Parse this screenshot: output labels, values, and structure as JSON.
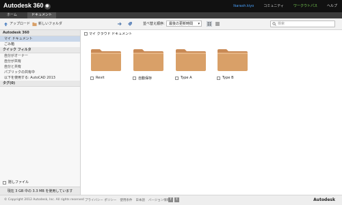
{
  "app": {
    "name": "Autodesk 360"
  },
  "topnav": {
    "user": "Ikarash.kiyo",
    "community": "コミュニティ",
    "buy": "ワークウトパス",
    "help": "ヘルプ"
  },
  "tabs": [
    {
      "label": "ホーム"
    },
    {
      "label": "ドキュメント"
    }
  ],
  "toolbar": {
    "upload": "アップロード",
    "new_folder": "新しいフォルダ",
    "sort_label": "並べ替え順序:",
    "sort_value": "最後の更新時間",
    "search_placeholder": "検索"
  },
  "sidebar": {
    "root": "Autodesk 360",
    "items": [
      {
        "label": "マイ ドキュメント"
      },
      {
        "label": "ごみ箱"
      }
    ],
    "filter_head": "クイック フィルタ",
    "filters": [
      {
        "label": "自分がオーナー"
      },
      {
        "label": "自分が共有"
      },
      {
        "label": "自分と共有"
      },
      {
        "label": "パブリックの共有中"
      },
      {
        "label": "以下を使用する: AutoCAD 2013"
      }
    ],
    "tags_head": "タグ(0)",
    "trash_label": "隠しファイル",
    "storage": "現在 3 GB 中の 3.3 MB を使用しています"
  },
  "content": {
    "breadcrumb": "マイ クラウド ドキュメント",
    "folders": [
      {
        "name": "Revit"
      },
      {
        "name": "自動保存"
      },
      {
        "name": "Type A"
      },
      {
        "name": "Type B"
      }
    ]
  },
  "footer": {
    "copyright": "© Copyright 2012 Autodesk, Inc. All rights reserved",
    "links": [
      "プライバシー ポリシー",
      "使用条件",
      "日本語",
      "バージョン情報"
    ],
    "brand": "Autodesk"
  },
  "colors": {
    "folder": "#d9a068",
    "topbar": "#111111",
    "selected": "#c9d7ea"
  }
}
